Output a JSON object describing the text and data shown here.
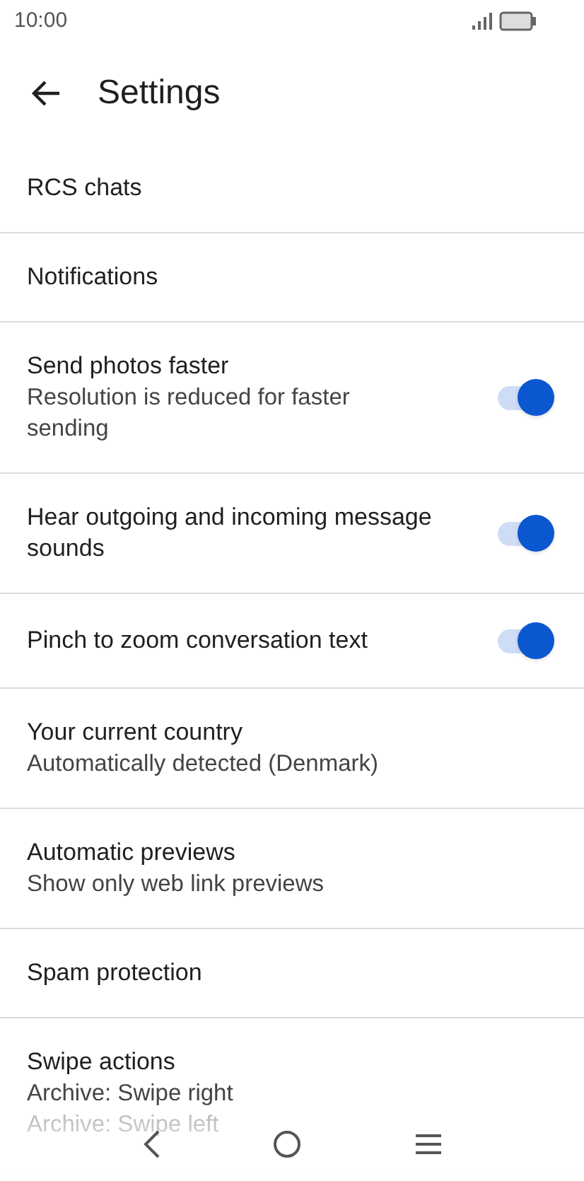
{
  "status_bar": {
    "time": "10:00"
  },
  "header": {
    "title": "Settings"
  },
  "settings": [
    {
      "kind": "link",
      "title": "RCS chats"
    },
    {
      "kind": "link",
      "title": "Notifications"
    },
    {
      "kind": "toggle",
      "title": "Send photos faster",
      "subtitle": "Resolution is reduced for faster sending",
      "on": true
    },
    {
      "kind": "toggle",
      "title": "Hear outgoing and incoming message sounds",
      "on": true
    },
    {
      "kind": "toggle",
      "title": "Pinch to zoom conversation text",
      "on": true
    },
    {
      "kind": "link",
      "title": "Your current country",
      "subtitle": "Automatically detected (Denmark)"
    },
    {
      "kind": "link",
      "title": "Automatic previews",
      "subtitle": "Show only web link previews"
    },
    {
      "kind": "link",
      "title": "Spam protection"
    },
    {
      "kind": "link",
      "title": "Swipe actions",
      "subtitle": "Archive: Swipe right",
      "subtitle_2": "Archive: Swipe left"
    }
  ]
}
